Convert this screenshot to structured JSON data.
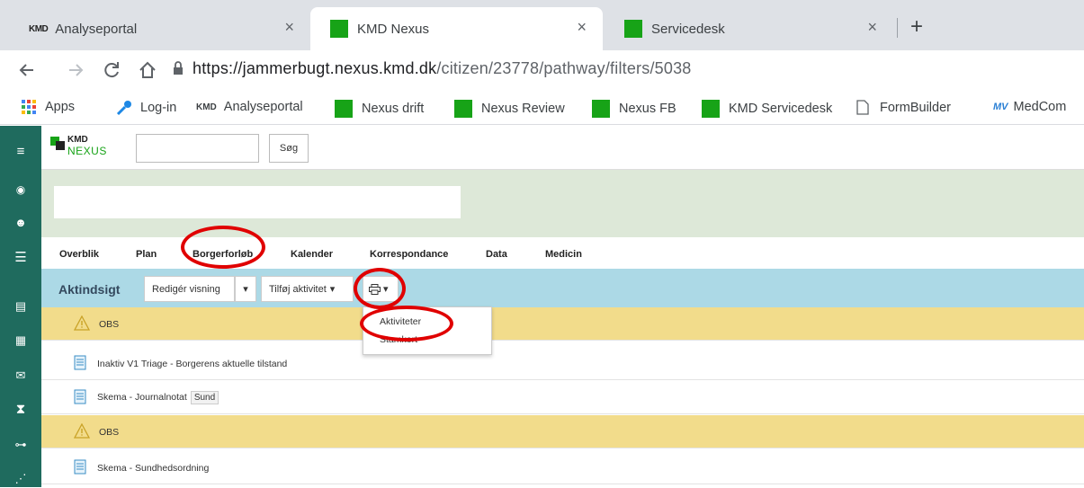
{
  "browser": {
    "tabs": [
      {
        "title": "Analyseportal",
        "favicon": "kmd-logo"
      },
      {
        "title": "KMD Nexus",
        "favicon": "green-square"
      },
      {
        "title": "Servicedesk",
        "favicon": "green-square"
      }
    ],
    "close_glyph": "×",
    "new_tab_glyph": "+",
    "url_host": "https://jammerbugt.nexus.kmd.dk",
    "url_path": "/citizen/23778/pathway/filters/5038",
    "bookmarks": [
      {
        "label": "Apps",
        "icon": "apps-grid-icon"
      },
      {
        "label": "Log-in",
        "icon": "key-icon"
      },
      {
        "label": "Analyseportal",
        "icon": "kmd-logo"
      },
      {
        "label": "Nexus drift",
        "icon": "green-square"
      },
      {
        "label": "Nexus Review",
        "icon": "green-square"
      },
      {
        "label": "Nexus FB",
        "icon": "green-square"
      },
      {
        "label": "KMD Servicedesk",
        "icon": "green-square"
      },
      {
        "label": "FormBuilder",
        "icon": "page-icon"
      },
      {
        "label": "MedCom",
        "icon": "medcom-logo"
      }
    ],
    "kmd_favicon_text": "KMD"
  },
  "app": {
    "logo_kmd": "KMD",
    "logo_nexus": "NEXUS",
    "search_button": "Søg",
    "search_placeholder": "",
    "nav_tabs": [
      "Overblik",
      "Plan",
      "Borgerforløb",
      "Kalender",
      "Korrespondance",
      "Data",
      "Medicin"
    ],
    "toolbar": {
      "title": "Aktindsigt",
      "edit_view": "Redigér visning",
      "add_activity": "Tilføj aktivitet",
      "caret": "▾",
      "print_icon": "printer-icon"
    },
    "dropdown": [
      "Aktiviteter",
      "Stamkort"
    ],
    "rows": [
      {
        "kind": "obs",
        "label": "OBS"
      },
      {
        "kind": "doc",
        "label": "Inaktiv V1 Triage - Borgerens aktuelle tilstand"
      },
      {
        "kind": "doc",
        "label": "Skema - Journalnotat",
        "tag": "Sund"
      },
      {
        "kind": "obs",
        "label": "OBS"
      },
      {
        "kind": "doc",
        "label": "Skema - Sundhedsordning"
      }
    ]
  },
  "colors": {
    "sidebar": "#1f6b5e",
    "citizen_bar": "#dde8d8",
    "toolbar": "#acd9e6",
    "obs_row": "#f2dc8b",
    "highlight_red": "#e00000",
    "nexus_green": "#17a317"
  }
}
